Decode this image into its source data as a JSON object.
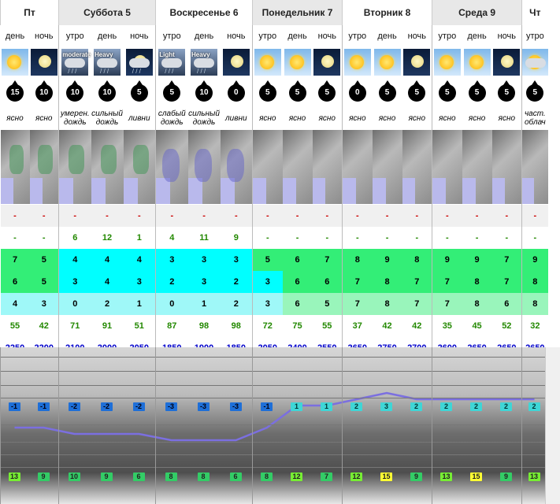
{
  "days": [
    {
      "label": "Пт",
      "cols": 2
    },
    {
      "label": "Суббота 5",
      "cols": 3
    },
    {
      "label": "Воскресенье 6",
      "cols": 3
    },
    {
      "label": "Понедельник 7",
      "cols": 3
    },
    {
      "label": "Вторник 8",
      "cols": 3
    },
    {
      "label": "Среда 9",
      "cols": 3
    },
    {
      "label": "Чт",
      "cols": 1
    }
  ],
  "periods": [
    "день",
    "ночь",
    "утро",
    "день",
    "ночь",
    "утро",
    "день",
    "ночь",
    "утро",
    "день",
    "ночь",
    "утро",
    "день",
    "ночь",
    "утро",
    "день",
    "ночь",
    "утро"
  ],
  "icons": [
    "sun-day",
    "moon-night",
    "rain-moderate",
    "rain-heavy",
    "showers-night",
    "rain-light",
    "rain-heavy",
    "moon-night",
    "sun-day",
    "sun-day",
    "moon-night",
    "sun-day",
    "sun-day",
    "moon-night",
    "sun-day",
    "sun-day",
    "moon-night",
    "cloudy-day"
  ],
  "icon_labels": [
    "",
    "",
    "moderate",
    "Heavy",
    "",
    "Light",
    "Heavy",
    "",
    "",
    "",
    "",
    "",
    "",
    "",
    "",
    "",
    "",
    ""
  ],
  "wind": [
    15,
    10,
    10,
    10,
    5,
    5,
    10,
    0,
    5,
    5,
    5,
    0,
    5,
    5,
    5,
    5,
    5,
    5
  ],
  "conditions": [
    "ясно",
    "ясно",
    "умерен. дождь",
    "сильный дождь",
    "ливни",
    "слабый дождь",
    "сильный дождь",
    "ливни",
    "ясно",
    "ясно",
    "ясно",
    "ясно",
    "ясно",
    "ясно",
    "ясно",
    "ясно",
    "ясно",
    "част. облач"
  ],
  "rows": {
    "r1": [
      "-",
      "-",
      "-",
      "-",
      "-",
      "-",
      "-",
      "-",
      "-",
      "-",
      "-",
      "-",
      "-",
      "-",
      "-",
      "-",
      "-",
      "-"
    ],
    "r2": [
      "-",
      "-",
      "6",
      "12",
      "1",
      "4",
      "11",
      "9",
      "-",
      "-",
      "-",
      "-",
      "-",
      "-",
      "-",
      "-",
      "-",
      "-"
    ],
    "r3": [
      "7",
      "5",
      "4",
      "4",
      "4",
      "3",
      "3",
      "3",
      "5",
      "6",
      "7",
      "8",
      "9",
      "8",
      "9",
      "9",
      "7",
      "9"
    ],
    "r4": [
      "6",
      "5",
      "3",
      "4",
      "3",
      "2",
      "3",
      "2",
      "3",
      "6",
      "6",
      "7",
      "8",
      "7",
      "7",
      "8",
      "7",
      "8"
    ],
    "r5": [
      "4",
      "3",
      "0",
      "2",
      "1",
      "0",
      "1",
      "2",
      "3",
      "6",
      "5",
      "7",
      "8",
      "7",
      "7",
      "8",
      "6",
      "8"
    ],
    "r6": [
      "55",
      "42",
      "71",
      "91",
      "51",
      "87",
      "98",
      "98",
      "72",
      "75",
      "55",
      "37",
      "42",
      "42",
      "35",
      "45",
      "52",
      "32"
    ],
    "r7": [
      "2250",
      "2200",
      "2100",
      "2000",
      "2050",
      "1850",
      "1900",
      "1850",
      "2050",
      "2400",
      "2550",
      "2650",
      "2750",
      "2700",
      "2600",
      "2650",
      "2650",
      "2650"
    ]
  },
  "graph": {
    "temps_top": [
      "-1",
      "-1",
      "-2",
      "-2",
      "-2",
      "-3",
      "-3",
      "-3",
      "-1",
      "1",
      "1",
      "2",
      "3",
      "2",
      "2",
      "2",
      "2",
      "2"
    ],
    "temps_bottom": [
      "13",
      "9",
      "10",
      "9",
      "6",
      "8",
      "8",
      "6",
      "8",
      "12",
      "7",
      "12",
      "15",
      "9",
      "13",
      "15",
      "9",
      "13"
    ]
  },
  "colors": {
    "cyan": "#00ffff",
    "light_cyan": "#9ff8f8",
    "green": "#33ee77",
    "light_green": "#99f5bb",
    "text_green": "#228800",
    "text_blue": "#0000cc",
    "text_red": "#cc0000",
    "curve": "#7b6fe0"
  }
}
